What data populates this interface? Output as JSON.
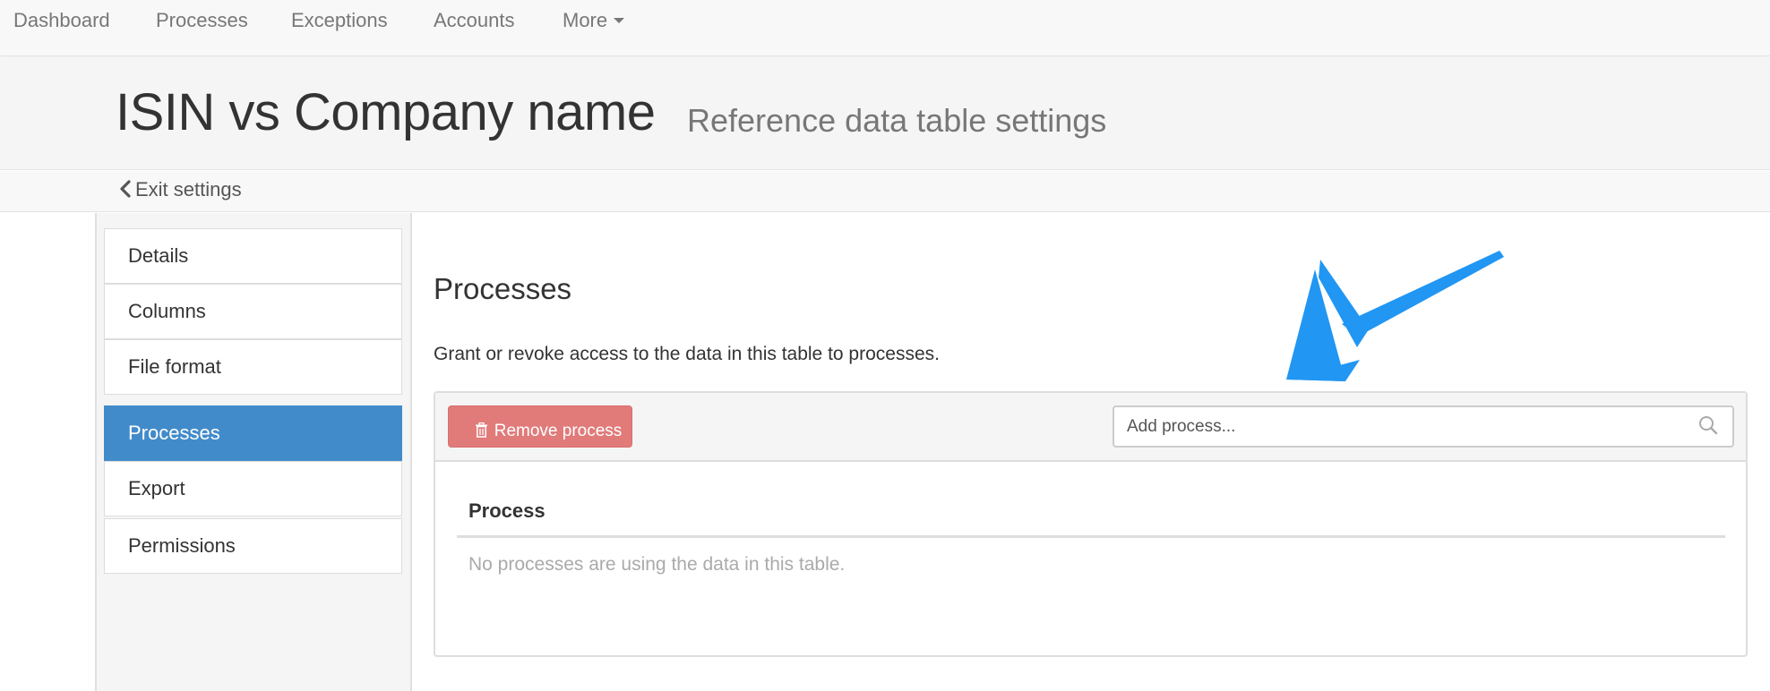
{
  "navbar": {
    "items": [
      {
        "label": "Dashboard"
      },
      {
        "label": "Processes"
      },
      {
        "label": "Exceptions"
      },
      {
        "label": "Accounts"
      },
      {
        "label": "More"
      }
    ]
  },
  "header": {
    "title": "ISIN vs Company name",
    "subtitle": "Reference data table settings"
  },
  "subbar": {
    "exit_label": "Exit settings",
    "exit_icon": "chevron-left-icon"
  },
  "sidebar": {
    "items": [
      {
        "label": "Details",
        "active": false
      },
      {
        "label": "Columns",
        "active": false
      },
      {
        "label": "File format",
        "active": false
      },
      {
        "label": "Processes",
        "active": true
      },
      {
        "label": "Export",
        "active": false
      },
      {
        "label": "Permissions",
        "active": false
      }
    ]
  },
  "main": {
    "section_title": "Processes",
    "description": "Grant or revoke access to the data in this table to processes.",
    "remove_button": {
      "label": "Remove process",
      "icon": "trash-icon"
    },
    "search": {
      "placeholder": "Add process...",
      "value": "",
      "icon": "search-icon"
    },
    "table": {
      "columns": [
        "Process"
      ],
      "rows": [],
      "empty_message": "No processes are using the data in this table."
    }
  },
  "annotation": {
    "type": "arrow",
    "color": "#2196f3"
  },
  "colors": {
    "active_menu": "#428bca",
    "danger_button": "#e07b7a",
    "navbar_bg": "#f8f8f8",
    "header_bg": "#f5f5f5"
  }
}
